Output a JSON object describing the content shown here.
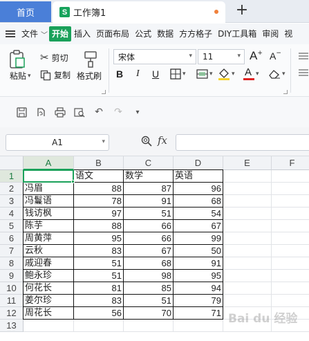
{
  "tabs": {
    "home_label": "首页",
    "doc_icon_letter": "S",
    "doc_title": "工作簿1",
    "new_tab_label": "+"
  },
  "menu": {
    "file_label": "文件",
    "items": [
      "开始",
      "插入",
      "页面布局",
      "公式",
      "数据",
      "方方格子",
      "DIY工具箱",
      "审阅",
      "视"
    ]
  },
  "ribbon": {
    "paste_label": "粘贴",
    "cut_label": "剪切",
    "copy_label": "复制",
    "format_painter_label": "格式刷",
    "font_name": "宋体",
    "font_size": "11",
    "bold": "B",
    "italic": "I",
    "underline": "U",
    "grow_font": "A",
    "shrink_font": "A",
    "font_color_glyph": "A",
    "accent_color": "#1aa15a",
    "font_color": "#e02020",
    "fill_color": "#f5d22a"
  },
  "formula_bar": {
    "name_box": "A1",
    "fx_label": "fx",
    "formula": ""
  },
  "sheet": {
    "columns": [
      "A",
      "B",
      "C",
      "D",
      "E",
      "F"
    ],
    "rows": [
      [
        "",
        "语文",
        "数学",
        "英语"
      ],
      [
        "冯眉",
        "88",
        "87",
        "96"
      ],
      [
        "冯鬘语",
        "78",
        "91",
        "68"
      ],
      [
        "钱访枫",
        "97",
        "51",
        "54"
      ],
      [
        "陈芋",
        "88",
        "66",
        "67"
      ],
      [
        "周黄萍",
        "95",
        "66",
        "99"
      ],
      [
        "云秋",
        "83",
        "67",
        "50"
      ],
      [
        "戚迎春",
        "51",
        "68",
        "91"
      ],
      [
        "鲍永珍",
        "51",
        "98",
        "95"
      ],
      [
        "何花长",
        "81",
        "85",
        "94"
      ],
      [
        "姜尔珍",
        "83",
        "51",
        "79"
      ],
      [
        "周花长",
        "56",
        "70",
        "71"
      ],
      [
        "",
        "",
        "",
        ""
      ]
    ],
    "row_numbers": [
      "1",
      "2",
      "3",
      "4",
      "5",
      "6",
      "7",
      "8",
      "9",
      "10",
      "11",
      "12",
      "13"
    ],
    "selected_cell": "A1"
  },
  "watermark": "Bai du 经验"
}
